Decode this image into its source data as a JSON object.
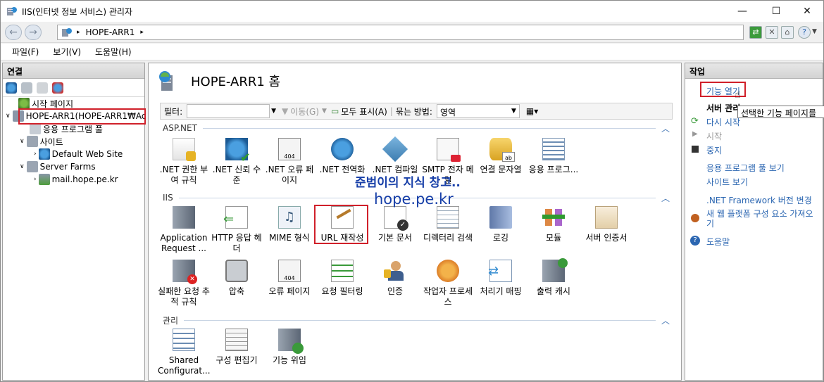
{
  "window": {
    "title": "IIS(인터넷 정보 서비스) 관리자",
    "minimize": "—",
    "maximize": "☐",
    "close": "✕"
  },
  "address": {
    "path": "HOPE-ARR1",
    "sep": "▸"
  },
  "menu": [
    "파일(F)",
    "보기(V)",
    "도움말(H)"
  ],
  "connections": {
    "title": "연결",
    "tree": [
      {
        "label": "시작 페이지"
      },
      {
        "label": "HOPE-ARR1(HOPE-ARR1₩Ac"
      },
      {
        "label": "응용 프로그램 풀"
      },
      {
        "label": "사이트"
      },
      {
        "label": "Default Web Site"
      },
      {
        "label": "Server Farms"
      },
      {
        "label": "mail.hope.pe.kr"
      }
    ]
  },
  "content": {
    "title": "HOPE-ARR1 홈",
    "filter": {
      "label": "필터:",
      "go": "이동(G)",
      "show_all": "모두 표시(A)",
      "group_by": "묶는 방법:",
      "group_value": "영역"
    },
    "sections": [
      "ASP.NET",
      "IIS",
      "관리"
    ],
    "aspnet": [
      ".NET 권한 부여 규칙",
      ".NET 신뢰 수준",
      ".NET 오류 페이지",
      ".NET 전역화",
      ".NET 컴파일",
      "SMTP 전자 메일",
      "연결 문자열",
      "응용 프로그..."
    ],
    "iis_row1": [
      "Application Request ...",
      "HTTP 응답 헤더",
      "MIME 형식",
      "URL 재작성",
      "기본 문서",
      "디렉터리 검색",
      "로깅",
      "모듈",
      "서버 인증서"
    ],
    "iis_row2": [
      "실패한 요청 추적 규칙",
      "압축",
      "오류 페이지",
      "요청 필터링",
      "인증",
      "작업자 프로세스",
      "처리기 매핑",
      "출력 캐시"
    ],
    "manage": [
      "Shared Configurat...",
      "구성 편집기",
      "기능 위임"
    ]
  },
  "watermark": {
    "line1": "준범이의 지식 창고..",
    "line2": "hope.pe.kr"
  },
  "actions": {
    "title": "작업",
    "open_feature": "기능 열기",
    "server_manage": "서버 관리",
    "restart": "다시 시작",
    "start": "시작",
    "stop": "중지",
    "view_pools": "응용 프로그램 풀 보기",
    "view_sites": "사이트 보기",
    "net_version": ".NET Framework 버전 변경",
    "get_components": "새 웹 플랫폼 구성 요소 가져오기",
    "help": "도움말",
    "tooltip": "선택한 기능 페이지를"
  }
}
